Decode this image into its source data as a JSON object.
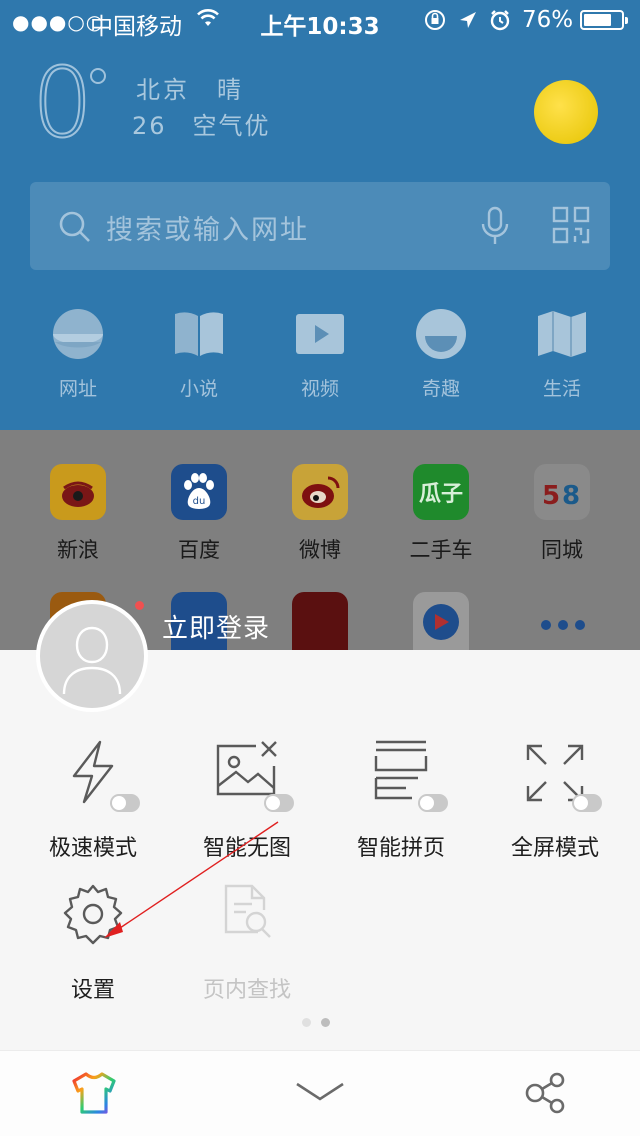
{
  "status_bar": {
    "signal_dots": "●●●○○",
    "carrier": "中国移动",
    "time": "上午10:33",
    "battery_percent": "76%",
    "battery_level": 0.76
  },
  "weather": {
    "temperature": "0",
    "city_condition": "北京　晴",
    "air_quality": "26　空气优"
  },
  "search": {
    "placeholder": "搜索或输入网址"
  },
  "quick_nav": [
    {
      "label": "网址",
      "icon": "globe-icon"
    },
    {
      "label": "小说",
      "icon": "book-icon"
    },
    {
      "label": "视频",
      "icon": "video-icon"
    },
    {
      "label": "奇趣",
      "icon": "smile-icon"
    },
    {
      "label": "生活",
      "icon": "map-icon"
    }
  ],
  "apps_row1": [
    {
      "label": "新浪",
      "icon": "sina-icon",
      "color": "#c99a1c"
    },
    {
      "label": "百度",
      "icon": "baidu-icon",
      "color": "#1e4d8c"
    },
    {
      "label": "微博",
      "icon": "weibo-icon",
      "color": "#c8a338"
    },
    {
      "label": "二手车",
      "icon": "guazi-icon",
      "color": "#1f8a2c"
    },
    {
      "label": "同城",
      "icon": "58-icon",
      "color": "#8a8a8a"
    }
  ],
  "login": {
    "label": "立即登录"
  },
  "menu": {
    "row1": [
      {
        "label": "极速模式",
        "icon": "lightning-icon"
      },
      {
        "label": "智能无图",
        "icon": "no-image-icon"
      },
      {
        "label": "智能拼页",
        "icon": "page-merge-icon"
      },
      {
        "label": "全屏模式",
        "icon": "fullscreen-icon"
      }
    ],
    "row2": [
      {
        "label": "设置",
        "icon": "gear-icon"
      },
      {
        "label": "页内查找",
        "icon": "find-in-page-icon"
      }
    ]
  },
  "pager": {
    "pages": 2,
    "active": 2
  },
  "annotation": {
    "color": "#e02020"
  }
}
